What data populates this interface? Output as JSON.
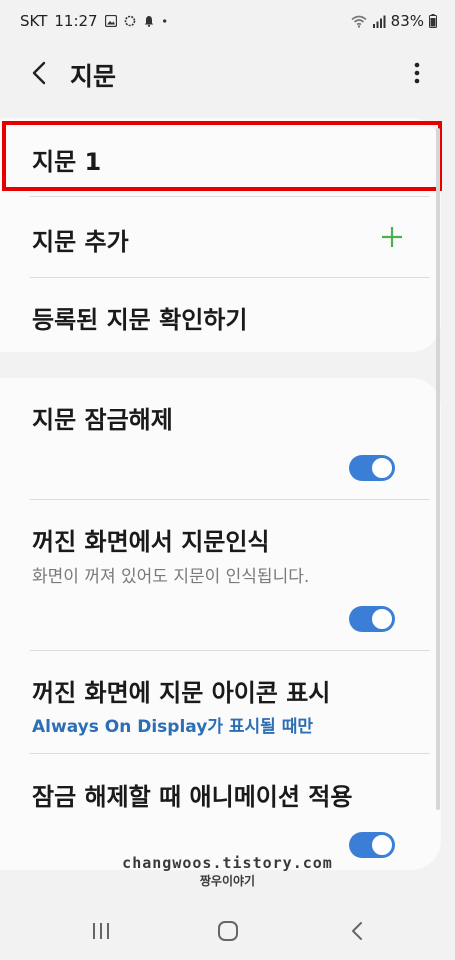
{
  "status_bar": {
    "carrier": "SKT",
    "time": "11:27",
    "icons": [
      "image-icon",
      "sync-icon",
      "bell-icon",
      "dot-icon"
    ],
    "right_icons": [
      "wifi-icon",
      "signal-icon",
      "battery-icon"
    ],
    "battery": "83%"
  },
  "app_bar": {
    "title": "지문",
    "back_icon": "chevron-left-icon",
    "more_icon": "more-vertical-icon"
  },
  "section1": {
    "items": [
      {
        "label": "지문 1"
      },
      {
        "label": "지문 추가",
        "icon": "plus-icon"
      },
      {
        "label": "등록된 지문 확인하기"
      }
    ]
  },
  "section2": {
    "items": [
      {
        "label": "지문 잠금해제",
        "toggle": true
      },
      {
        "label": "꺼진 화면에서 지문인식",
        "subtitle": "화면이 꺼져 있어도 지문이 인식됩니다.",
        "toggle": true
      },
      {
        "label": "꺼진 화면에 지문 아이콘 표시",
        "subtitle": "Always On Display가 표시될 때만"
      },
      {
        "label": "잠금 해제할 때 애니메이션 적용",
        "toggle": true
      }
    ]
  },
  "watermark": {
    "line1": "changwoos.tistory.com",
    "line2": "짱우이야기"
  },
  "colors": {
    "accent": "#3a7fd5",
    "plus": "#4caf50",
    "highlight": "#e60000",
    "link": "#2d6fb5"
  },
  "nav_bar": {
    "icons": [
      "recents-icon",
      "home-icon",
      "back-icon"
    ]
  }
}
